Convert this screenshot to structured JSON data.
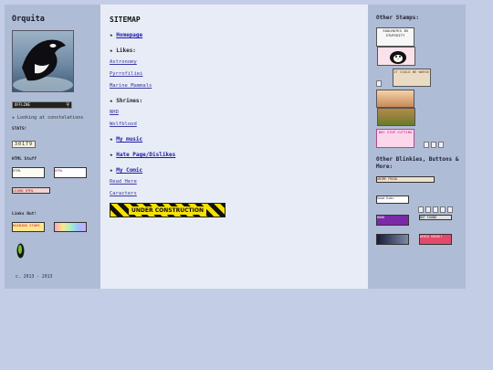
{
  "left": {
    "title": "Orquita",
    "offline_badge": "OFFLINE",
    "status": "Looking at constelations",
    "stats_label": "STATS!",
    "counter": "30179",
    "html_stuff_label": "HTML Stuff",
    "html_buttons": [
      "HTML",
      "HTML",
      "LEARN HTML"
    ],
    "links_out_label": "Links Out!",
    "links_out_button": "RAINING STARS",
    "copyright": "c. 2013 - 2013"
  },
  "main": {
    "heading": "SITEMAP",
    "homepage": "Homepage",
    "likes_heading": "Likes:",
    "likes": [
      "Astronomy",
      "Pyrrofiliei",
      "Marine Mammals"
    ],
    "shrines_heading": "Shrines:",
    "shrines": [
      "NHD",
      "Wolfblood"
    ],
    "music": "My music",
    "hate": "Hate Page/Dislikes",
    "comic": "My Comic",
    "comic_links": [
      "Read Here",
      "Caracters"
    ],
    "construction": "UNDER CONSTRUCTION"
  },
  "right": {
    "stamps_heading": "Other Stamps:",
    "stamps": [
      "SOULMATES IN STUPIDITY",
      "",
      "IT COULD BE WORSE",
      "",
      "",
      "BOY STOP CUTTING"
    ],
    "blinkies_heading": "Other Blinkies, Buttons & More:",
    "blinkies": [
      "ANIME FREAK",
      "Good Kidz",
      "",
      "BOOK",
      "NOT FOUND",
      "",
      "WIKIA SUCKS!"
    ]
  },
  "colors": {
    "panel": "#aebcd6",
    "main": "#e8ecf6",
    "background": "#c3cee6",
    "link": "#1a1aa8",
    "construction": "#f6e100"
  }
}
